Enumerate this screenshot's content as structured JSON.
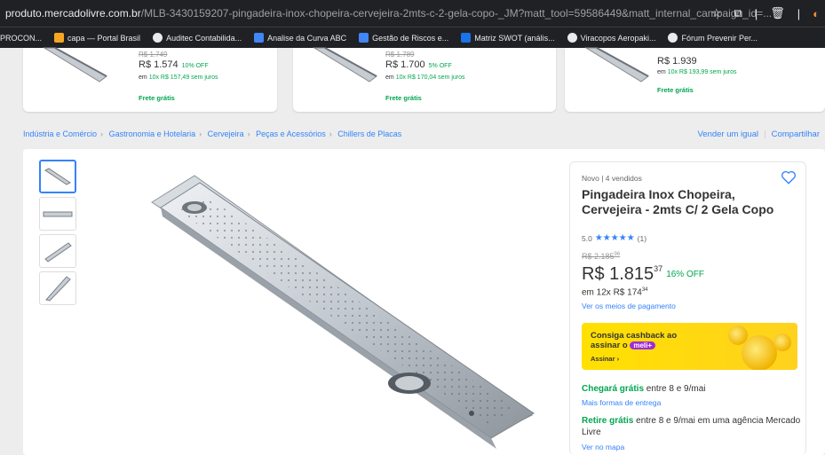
{
  "browser": {
    "url_host": "produto.mercadolivre.com.br",
    "url_path": "/MLB-3430159207-pingadeira-inox-chopeira-cervejeira-2mts-c-2-gela-copo-_JM?matt_tool=59586449&matt_internal_campaign_id=...",
    "bookmarks": [
      {
        "label": "PROCON...",
        "icon": "procon-icon"
      },
      {
        "label": "capa — Portal Brasil",
        "icon": "bookmark-icon"
      },
      {
        "label": "Auditec Contabilida...",
        "icon": "globe-icon"
      },
      {
        "label": "Analise da Curva ABC",
        "icon": "doc-icon"
      },
      {
        "label": "Gestão de Riscos e...",
        "icon": "doc-icon"
      },
      {
        "label": "Matriz SWOT (anális...",
        "icon": "sheet-icon"
      },
      {
        "label": "Viracopos Aeropaki...",
        "icon": "globe-icon"
      },
      {
        "label": "Fórum Prevenir Per...",
        "icon": "globe-icon"
      }
    ]
  },
  "cards": [
    {
      "old": "R$ 1.749",
      "price": "R$ 1.574",
      "off": "10% OFF",
      "inst": "10x R$ 157,49 sem juros",
      "ship": "Frete grátis"
    },
    {
      "old": "R$ 1.789",
      "price": "R$ 1.700",
      "off": "5% OFF",
      "inst": "10x R$ 170,04 sem juros",
      "ship": "Frete grátis"
    },
    {
      "old": "",
      "price": "R$ 1.939",
      "off": "",
      "inst": "10x R$ 193,99 sem juros",
      "ship": "Frete grátis"
    }
  ],
  "inst_prefix": "em",
  "breadcrumb": [
    "Indústria e Comércio",
    "Gastronomia e Hotelaria",
    "Cervejeira",
    "Peças e Acessórios",
    "Chillers de Placas"
  ],
  "links": {
    "sell": "Vender um igual",
    "share": "Compartilhar"
  },
  "product": {
    "condition": "Novo | 4 vendidos",
    "title": "Pingadeira Inox Chopeira, Cervejeira - 2mts C/ 2 Gela Copo",
    "rating_value": "5.0",
    "rating_stars": "★★★★★",
    "rating_count": "(1)",
    "old_price": "R$ 2.185",
    "old_cents": "96",
    "price": "R$ 1.815",
    "price_cents": "37",
    "discount": "16% OFF",
    "installments": "em 12x R$ 174",
    "installments_cents": "34",
    "payment_link": "Ver os meios de pagamento",
    "cashback_title": "Consiga cashback ao assinar o",
    "cashback_brand": "meli+",
    "cashback_cta": "Assinar ›",
    "ship1_strong": "Chegará grátis",
    "ship1_rest": " entre 8 e 9/mai",
    "ship1_link": "Mais formas de entrega",
    "ship2_strong": "Retire grátis",
    "ship2_rest": " entre 8 e 9/mai em uma agência Mercado Livre",
    "ship2_link": "Ver no mapa"
  },
  "colors": {
    "link": "#3483fa",
    "green": "#00a650",
    "accent": "#ffe600"
  }
}
